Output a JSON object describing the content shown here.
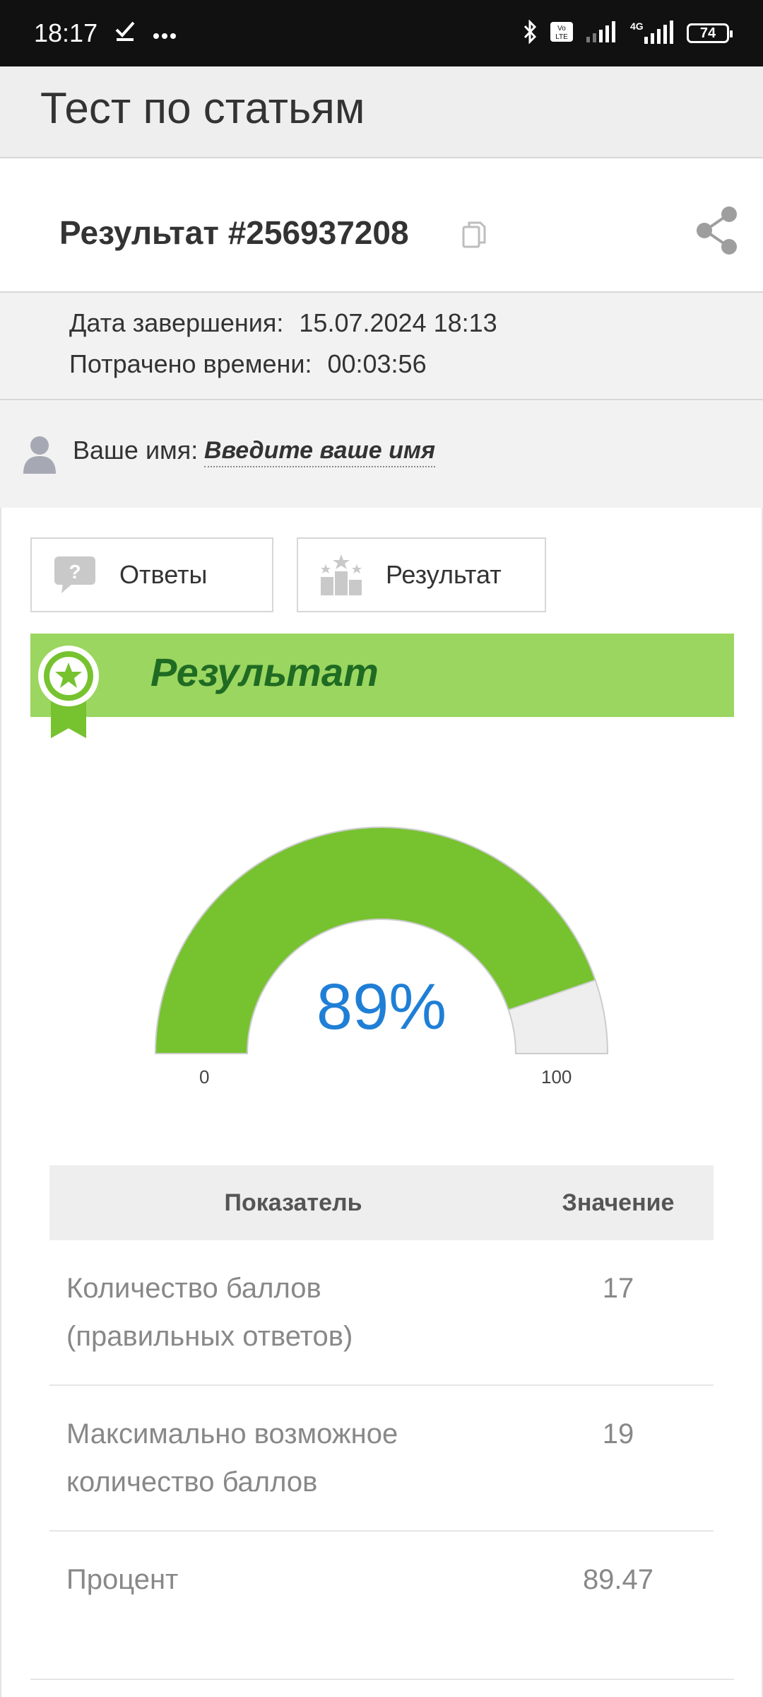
{
  "status_bar": {
    "time": "18:17",
    "battery": "74",
    "network": "4G",
    "icons": [
      "check-icon",
      "more-dots-icon",
      "bluetooth-icon",
      "volte-icon",
      "signal-icon",
      "battery-icon"
    ]
  },
  "page": {
    "title": "Тест по статьям"
  },
  "result": {
    "title": "Результат #256937208",
    "copy_icon": "copy-icon",
    "share_icon": "share-icon"
  },
  "meta": {
    "finish_label": "Дата завершения:",
    "finish_value": "15.07.2024 18:13",
    "time_label": "Потрачено времени:",
    "time_value": "00:03:56"
  },
  "name": {
    "label": "Ваше имя:",
    "placeholder": "Введите ваше имя"
  },
  "tabs": [
    {
      "label": "Ответы",
      "icon": "question-bubble-icon"
    },
    {
      "label": "Результат",
      "icon": "podium-icon"
    }
  ],
  "banner": {
    "title": "Результат",
    "icon": "award-ribbon-icon"
  },
  "gauge": {
    "value_text": "89%",
    "value": 89.47,
    "min": "0",
    "max": "100",
    "fill_color": "#76c22f",
    "rest_color": "#eeeeee"
  },
  "table": {
    "headers": [
      "Показатель",
      "Значение"
    ],
    "rows": [
      {
        "label_line1": "Количество баллов",
        "label_line2": "(правильных ответов)",
        "value": "17"
      },
      {
        "label_line1": "Максимально возможное",
        "label_line2": "количество баллов",
        "value": "19"
      },
      {
        "label_line1": "Процент",
        "label_line2": "",
        "value": "89.47"
      }
    ]
  }
}
